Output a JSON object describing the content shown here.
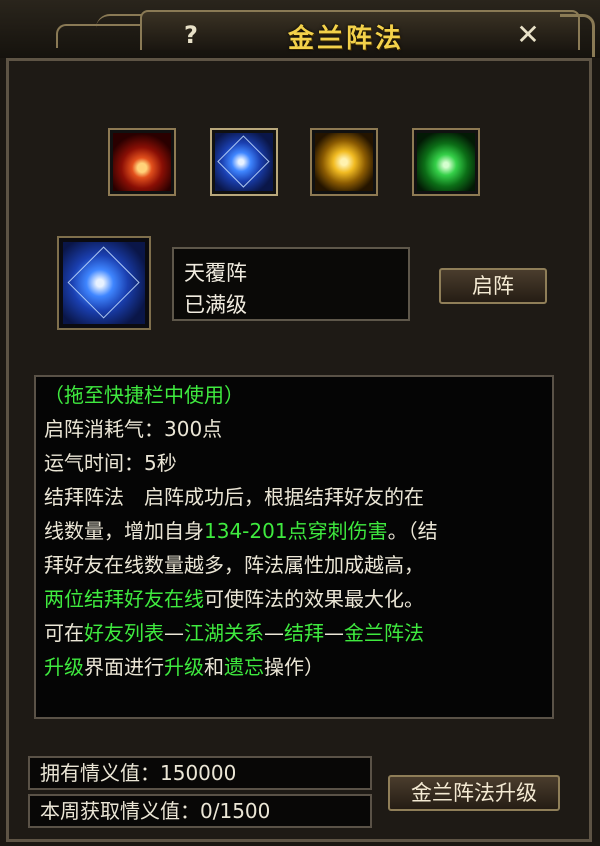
{
  "window": {
    "title": "金兰阵法",
    "help_label": "?",
    "close_label": "✕"
  },
  "skills": [
    {
      "name": "fire-formation",
      "icon": "fire-circle-icon"
    },
    {
      "name": "water-formation",
      "icon": "blue-star-icon"
    },
    {
      "name": "gold-formation",
      "icon": "gold-circle-icon"
    },
    {
      "name": "green-formation",
      "icon": "green-triangle-icon"
    }
  ],
  "selected": {
    "name": "天覆阵",
    "level": "已满级",
    "activate_label": "启阵"
  },
  "description": {
    "line1": "（拖至快捷栏中使用）",
    "line2": "启阵消耗气：300点",
    "line3": "运气时间：5秒",
    "line4": "结拜阵法　启阵成功后，根据结拜好友的在",
    "line5_a": "线数量，增加自身",
    "line5_b": "134-201点穿刺伤害",
    "line5_c": "。（结",
    "line6": "拜好友在线数量越多，阵法属性加成越高，",
    "line7_a": "两位结拜好友在线",
    "line7_b": "可使阵法的效果最大化。",
    "line8_a": "可在",
    "line8_b": "好友列表",
    "line8_c": "—",
    "line8_d": "江湖关系",
    "line8_e": "—",
    "line8_f": "结拜",
    "line8_g": "—",
    "line8_h": "金兰阵法",
    "line9_a": "升级",
    "line9_b": "界面进行",
    "line9_c": "升级",
    "line9_d": "和",
    "line9_e": "遗忘",
    "line9_f": "操作）"
  },
  "stats": {
    "loyalty_label": "拥有情义值：",
    "loyalty_value": "150000",
    "weekly_label": "本周获取情义值：",
    "weekly_value": "0/1500"
  },
  "upgrade_label": "金兰阵法升级",
  "colors": {
    "title": "#f3d14a",
    "highlight": "#3fea3f",
    "text": "#ebe6d6",
    "frame": "#8e7a53"
  }
}
